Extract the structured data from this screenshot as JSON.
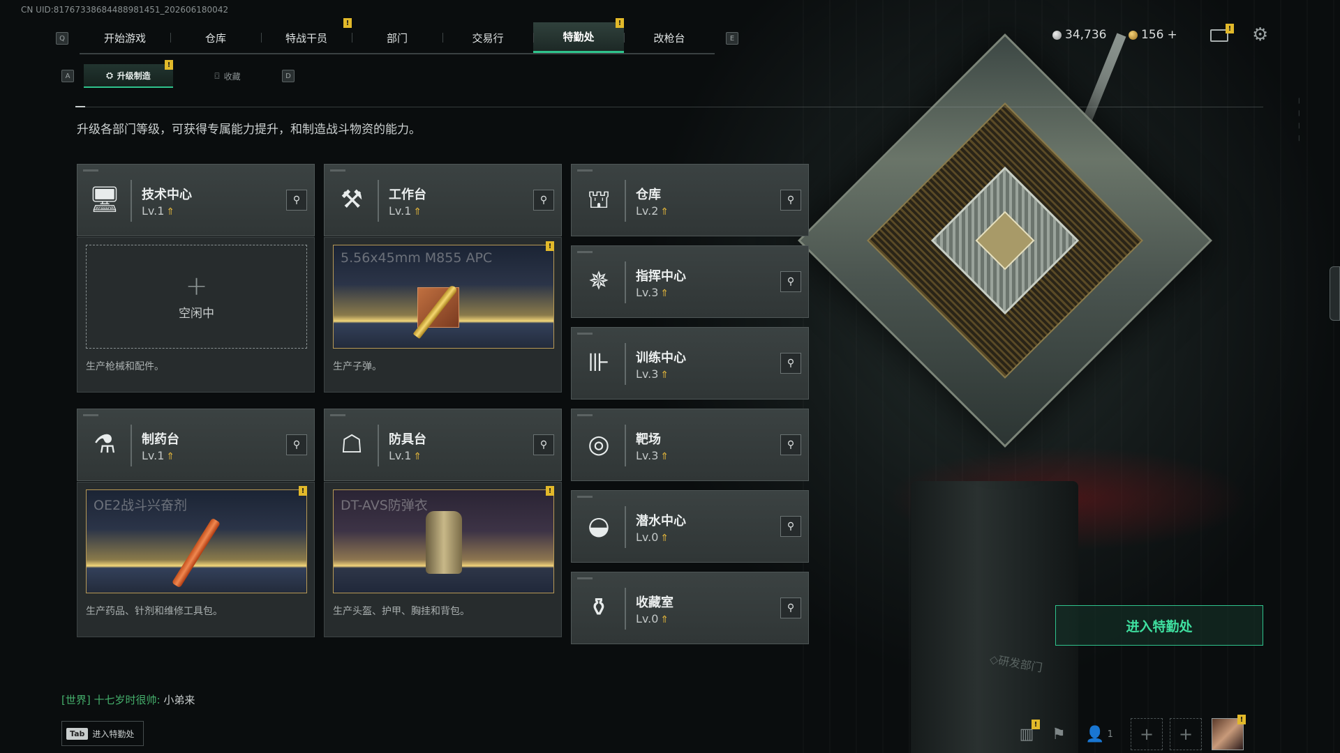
{
  "uid": "CN UID:81767338684488981451_202606180042",
  "nav": {
    "key_left": "Q",
    "key_right": "E",
    "tabs": [
      {
        "label": "开始游戏",
        "badge": ""
      },
      {
        "label": "仓库",
        "badge": ""
      },
      {
        "label": "特战干员",
        "badge": "!"
      },
      {
        "label": "部门",
        "badge": ""
      },
      {
        "label": "交易行",
        "badge": ""
      },
      {
        "label": "特勤处",
        "badge": "!",
        "active": true
      },
      {
        "label": "改枪台",
        "badge": ""
      }
    ]
  },
  "currency": {
    "silver": "34,736",
    "gold": "156",
    "gold_add": "+"
  },
  "mail_badge": "!",
  "subtabs": {
    "key_left": "A",
    "key_right": "D",
    "items": [
      {
        "label": "升级制造",
        "icon": "upgrade-icon",
        "badge": "!",
        "active": true
      },
      {
        "label": "收藏",
        "icon": "collection-icon",
        "badge": ""
      }
    ]
  },
  "description": "升级各部门等级，可获得专属能力提升，和制造战斗物资的能力。",
  "departments": [
    {
      "name": "技术中心",
      "level": "Lv.1",
      "icon": "monitor-icon",
      "glyph": "🖥"
    },
    {
      "name": "工作台",
      "level": "Lv.1",
      "icon": "tools-icon",
      "glyph": "⚒"
    },
    {
      "name": "仓库",
      "level": "Lv.2",
      "icon": "warehouse-icon",
      "glyph": "⛫"
    },
    {
      "name": "指挥中心",
      "level": "Lv.3",
      "icon": "command-icon",
      "glyph": "✵"
    },
    {
      "name": "训练中心",
      "level": "Lv.3",
      "icon": "dumbbell-icon",
      "glyph": "⊪"
    },
    {
      "name": "制药台",
      "level": "Lv.1",
      "icon": "microscope-icon",
      "glyph": "⚗"
    },
    {
      "name": "防具台",
      "level": "Lv.1",
      "icon": "armor-icon",
      "glyph": "☖"
    },
    {
      "name": "靶场",
      "level": "Lv.3",
      "icon": "target-icon",
      "glyph": "◎"
    },
    {
      "name": "潜水中心",
      "level": "Lv.0",
      "icon": "diving-mask-icon",
      "glyph": "◒"
    },
    {
      "name": "收藏室",
      "level": "Lv.0",
      "icon": "collection-room-icon",
      "glyph": "⚱"
    }
  ],
  "productions": {
    "tech": {
      "status": "空闲中",
      "desc": "生产枪械和配件。"
    },
    "workbench": {
      "item": "5.56x45mm M855 APC",
      "desc": "生产子弹。",
      "badge": "!"
    },
    "pharma": {
      "item": "OE2战斗兴奋剂",
      "desc": "生产药品、针剂和维修工具包。",
      "badge": "!"
    },
    "armor": {
      "item": "DT-AVS防弹衣",
      "desc": "生产头盔、护甲、胸挂和背包。",
      "badge": "!"
    }
  },
  "enter_button": "进入特勤处",
  "chat": {
    "channel": "[世界]",
    "user": "十七岁时很帅:",
    "message": "小弟来"
  },
  "tab_hint": {
    "key": "Tab",
    "label": "进入特勤处"
  },
  "bottom": {
    "friends_count": "1",
    "stats_badge": "!",
    "avatar_badge": "!"
  },
  "dept_logo": "◇研发部门"
}
